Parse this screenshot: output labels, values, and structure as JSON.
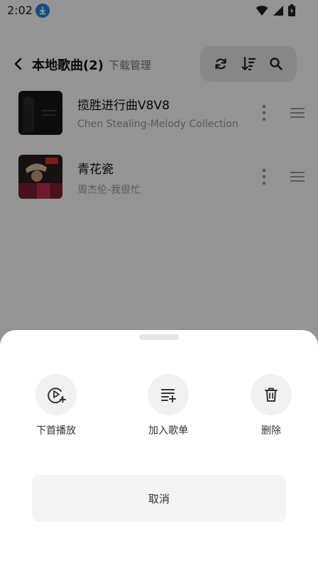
{
  "status_bar": {
    "time": "2:02"
  },
  "header": {
    "title": "本地歌曲(2)",
    "download_manage": "下载管理"
  },
  "songs": [
    {
      "title": "揽胜进行曲V8V8",
      "artist": "Chen Stealing-Melody Collection"
    },
    {
      "title": "青花瓷",
      "artist": "周杰伦-我很忙"
    }
  ],
  "sheet": {
    "actions": [
      {
        "label": "下首播放",
        "icon": "play-next-icon"
      },
      {
        "label": "加入歌单",
        "icon": "add-to-playlist-icon"
      },
      {
        "label": "删除",
        "icon": "trash-icon"
      }
    ],
    "cancel_label": "取消"
  },
  "colors": {
    "accent_blue": "#1e88e5",
    "overlay": "rgba(0,0,0,0.42)",
    "sheet_bg": "#ffffff"
  }
}
